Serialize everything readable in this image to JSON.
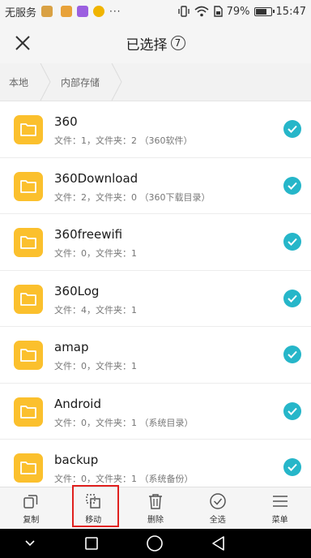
{
  "status_bar": {
    "carrier": "无服务",
    "battery": "79%",
    "battery_level": 0.79,
    "time": "15:47",
    "more": "···"
  },
  "header": {
    "title": "已选择",
    "selected_count": "7",
    "close_icon": "close-icon"
  },
  "breadcrumb": [
    {
      "label": "本地"
    },
    {
      "label": "内部存储"
    }
  ],
  "files": [
    {
      "name": "360",
      "meta": "文件：1，文件夹：2 （360软件）",
      "checked": true
    },
    {
      "name": "360Download",
      "meta": "文件：2，文件夹：0 （360下载目录）",
      "checked": true
    },
    {
      "name": "360freewifi",
      "meta": "文件：0，文件夹：1",
      "checked": true
    },
    {
      "name": "360Log",
      "meta": "文件：4，文件夹：1",
      "checked": true
    },
    {
      "name": "amap",
      "meta": "文件：0，文件夹：1",
      "checked": true
    },
    {
      "name": "Android",
      "meta": "文件：0，文件夹：1 （系统目录）",
      "checked": true
    },
    {
      "name": "backup",
      "meta": "文件：0，文件夹：1 （系统备份）",
      "checked": true
    }
  ],
  "toolbar": {
    "copy": "复制",
    "move": "移动",
    "delete": "删除",
    "select_all": "全选",
    "menu": "菜单"
  },
  "colors": {
    "folder": "#fbc02d",
    "check": "#26b6c9",
    "highlight": "#e0201e"
  }
}
